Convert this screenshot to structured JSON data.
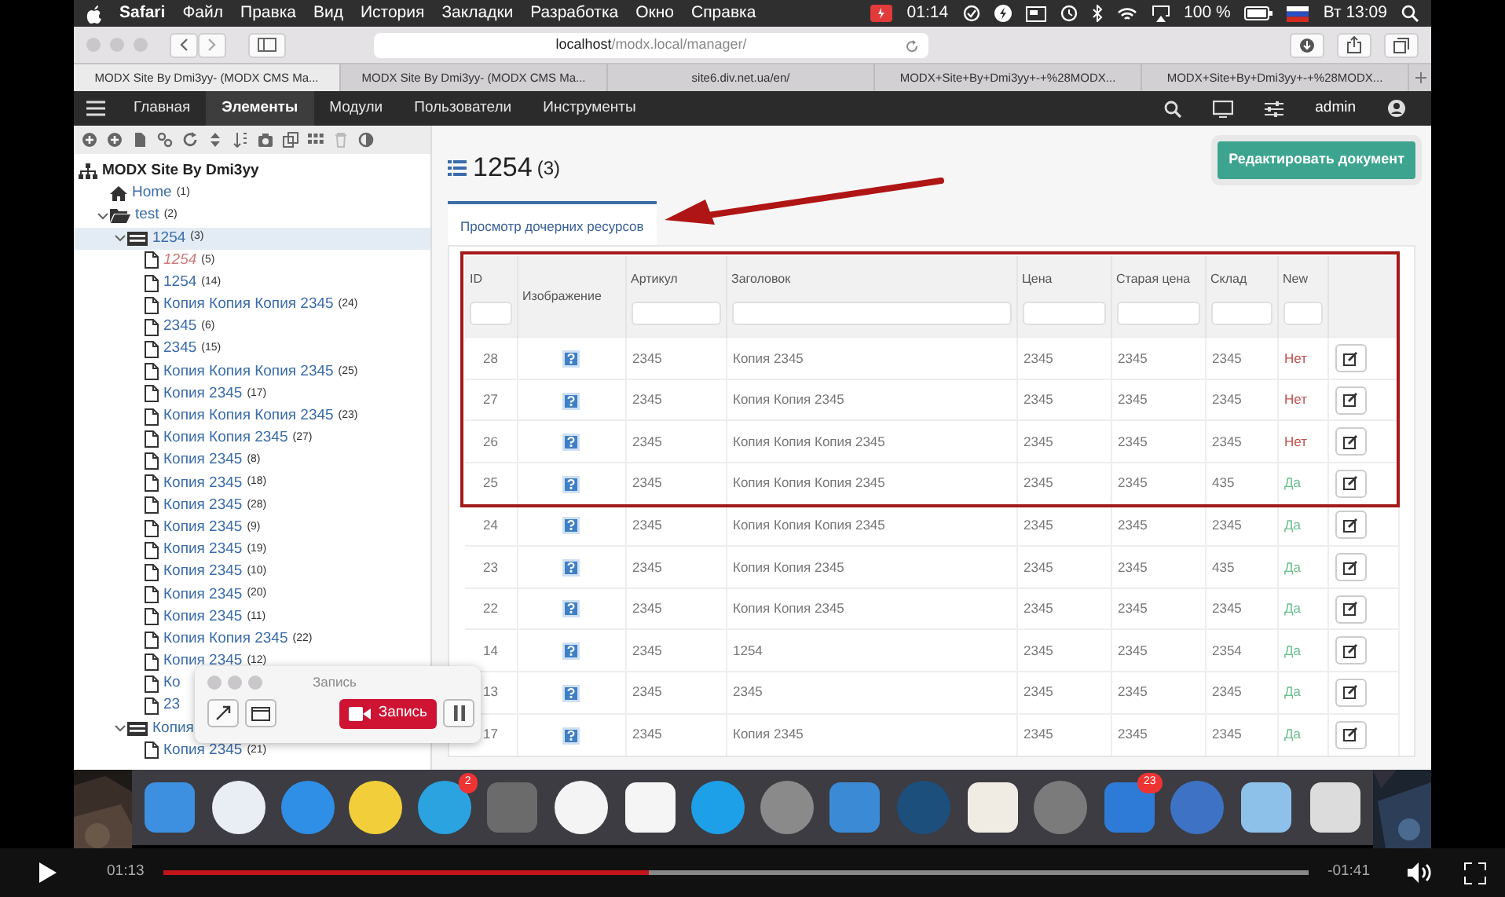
{
  "menubar": {
    "app": "Safari",
    "menus": [
      "Файл",
      "Правка",
      "Вид",
      "История",
      "Закладки",
      "Разработка",
      "Окно",
      "Справка"
    ],
    "recording_time": "01:14",
    "battery": "100 %",
    "clock": "Вт 13:09"
  },
  "safari": {
    "address": "**localhost**/modx.local/manager/",
    "tabs": [
      {
        "title": "MODX Site By Dmi3yy- (MODX CMS Ma...",
        "selected": true
      },
      {
        "title": "MODX Site By Dmi3yy- (MODX CMS Ma...",
        "selected": false
      },
      {
        "title": "site6.div.net.ua/en/",
        "selected": false
      },
      {
        "title": "MODX+Site+By+Dmi3yy+-+%28MODX...",
        "selected": false
      },
      {
        "title": "MODX+Site+By+Dmi3yy+-+%28MODX...",
        "selected": false
      }
    ]
  },
  "nav": {
    "items": [
      {
        "label": "Главная",
        "selected": false
      },
      {
        "label": "Элементы",
        "selected": true
      },
      {
        "label": "Модули",
        "selected": false
      },
      {
        "label": "Пользователи",
        "selected": false
      },
      {
        "label": "Инструменты",
        "selected": false
      }
    ],
    "user": "admin"
  },
  "tree": {
    "root": {
      "kind": "site",
      "label": "MODX Site By Dmi3yy",
      "selected": false,
      "children": [
        {
          "kind": "home",
          "label": "Home",
          "count": "(1)",
          "selected": false,
          "unpublished": false
        },
        {
          "kind": "folder",
          "label": "test",
          "count": "(2)",
          "selected": false,
          "unpublished": false,
          "expanded": true,
          "children": [
            {
              "kind": "container",
              "label": "1254",
              "count": "(3)",
              "selected": true,
              "unpublished": false,
              "expanded": true,
              "children": [
                {
                  "kind": "doc",
                  "label": "1254",
                  "count": "(5)",
                  "selected": false,
                  "unpublished": true
                },
                {
                  "kind": "doc",
                  "label": "1254",
                  "count": "(14)",
                  "selected": false,
                  "unpublished": false
                },
                {
                  "kind": "doc",
                  "label": "Копия Копия Копия 2345",
                  "count": "(24)",
                  "selected": false,
                  "unpublished": false
                },
                {
                  "kind": "doc",
                  "label": "2345",
                  "count": "(6)",
                  "selected": false,
                  "unpublished": false
                },
                {
                  "kind": "doc",
                  "label": "2345",
                  "count": "(15)",
                  "selected": false,
                  "unpublished": false
                },
                {
                  "kind": "doc",
                  "label": "Копия Копия Копия 2345",
                  "count": "(25)",
                  "selected": false,
                  "unpublished": false
                },
                {
                  "kind": "doc",
                  "label": "Копия 2345",
                  "count": "(17)",
                  "selected": false,
                  "unpublished": false
                },
                {
                  "kind": "doc",
                  "label": "Копия Копия Копия 2345",
                  "count": "(23)",
                  "selected": false,
                  "unpublished": false
                },
                {
                  "kind": "doc",
                  "label": "Копия Копия 2345",
                  "count": "(27)",
                  "selected": false,
                  "unpublished": false
                },
                {
                  "kind": "doc",
                  "label": "Копия 2345",
                  "count": "(8)",
                  "selected": false,
                  "unpublished": false
                },
                {
                  "kind": "doc",
                  "label": "Копия 2345",
                  "count": "(18)",
                  "selected": false,
                  "unpublished": false
                },
                {
                  "kind": "doc",
                  "label": "Копия 2345",
                  "count": "(28)",
                  "selected": false,
                  "unpublished": false
                },
                {
                  "kind": "doc",
                  "label": "Копия 2345",
                  "count": "(9)",
                  "selected": false,
                  "unpublished": false
                },
                {
                  "kind": "doc",
                  "label": "Копия 2345",
                  "count": "(19)",
                  "selected": false,
                  "unpublished": false
                },
                {
                  "kind": "doc",
                  "label": "Копия 2345",
                  "count": "(10)",
                  "selected": false,
                  "unpublished": false
                },
                {
                  "kind": "doc",
                  "label": "Копия 2345",
                  "count": "(20)",
                  "selected": false,
                  "unpublished": false
                },
                {
                  "kind": "doc",
                  "label": "Копия 2345",
                  "count": "(11)",
                  "selected": false,
                  "unpublished": false
                },
                {
                  "kind": "doc",
                  "label": "Копия Копия 2345",
                  "count": "(22)",
                  "selected": false,
                  "unpublished": false
                },
                {
                  "kind": "doc",
                  "label": "Копия 2345",
                  "count": "(12)",
                  "selected": false,
                  "unpublished": false
                },
                {
                  "kind": "doc",
                  "label": "Ко",
                  "selected": false,
                  "unpublished": false
                },
                {
                  "kind": "doc",
                  "label": "23",
                  "selected": false,
                  "unpublished": false
                }
              ]
            },
            {
              "kind": "container",
              "label": "Копия",
              "selected": false,
              "unpublished": false,
              "expanded": true,
              "children": [
                {
                  "kind": "doc",
                  "label": "Копия 2345",
                  "count": "(21)",
                  "selected": false,
                  "unpublished": false
                }
              ]
            }
          ]
        }
      ]
    }
  },
  "main": {
    "title": "1254",
    "count": "(3)",
    "edit_button": "Редактировать документ",
    "tabs": [
      {
        "label": "Просмотр дочерних ресурсов",
        "selected": true
      }
    ],
    "table": {
      "columns": [
        {
          "label": "ID",
          "filter": true
        },
        {
          "label": "Изображение",
          "filter": false
        },
        {
          "label": "Артикул",
          "filter": true
        },
        {
          "label": "Заголовок",
          "filter": true
        },
        {
          "label": "Цена",
          "filter": true
        },
        {
          "label": "Старая цена",
          "filter": true
        },
        {
          "label": "Склад",
          "filter": true
        },
        {
          "label": "New",
          "filter": true
        }
      ],
      "rows": [
        {
          "id": "28",
          "sku": "2345",
          "title": "Копия 2345",
          "price": "2345",
          "old_price": "2345",
          "stock": "2345",
          "new": "Нет",
          "is_new": false
        },
        {
          "id": "27",
          "sku": "2345",
          "title": "Копия Копия 2345",
          "price": "2345",
          "old_price": "2345",
          "stock": "2345",
          "new": "Нет",
          "is_new": false
        },
        {
          "id": "26",
          "sku": "2345",
          "title": "Копия Копия Копия 2345",
          "price": "2345",
          "old_price": "2345",
          "stock": "2345",
          "new": "Нет",
          "is_new": false
        },
        {
          "id": "25",
          "sku": "2345",
          "title": "Копия Копия Копия 2345",
          "price": "2345",
          "old_price": "2345",
          "stock": "435",
          "new": "Да",
          "is_new": true
        },
        {
          "id": "24",
          "sku": "2345",
          "title": "Копия Копия Копия 2345",
          "price": "2345",
          "old_price": "2345",
          "stock": "2345",
          "new": "Да",
          "is_new": true
        },
        {
          "id": "23",
          "sku": "2345",
          "title": "Копия Копия 2345",
          "price": "2345",
          "old_price": "2345",
          "stock": "435",
          "new": "Да",
          "is_new": true
        },
        {
          "id": "22",
          "sku": "2345",
          "title": "Копия Копия 2345",
          "price": "2345",
          "old_price": "2345",
          "stock": "2345",
          "new": "Да",
          "is_new": true
        },
        {
          "id": "14",
          "sku": "2345",
          "title": "1254",
          "price": "2345",
          "old_price": "2345",
          "stock": "2354",
          "new": "Да",
          "is_new": true
        },
        {
          "id": "13",
          "sku": "2345",
          "title": "2345",
          "price": "2345",
          "old_price": "2345",
          "stock": "2345",
          "new": "Да",
          "is_new": true
        },
        {
          "id": "17",
          "sku": "2345",
          "title": "Копия 2345",
          "price": "2345",
          "old_price": "2345",
          "stock": "2345",
          "new": "Да",
          "is_new": true
        }
      ]
    }
  },
  "recorder": {
    "title": "Запись",
    "record_button": "Запись"
  },
  "dock": {
    "apps": [
      {
        "kind": "square",
        "color": "#3d8fe0"
      },
      {
        "kind": "circle",
        "color": "#e9eef4"
      },
      {
        "kind": "circle",
        "color": "#2f8ee6"
      },
      {
        "kind": "circle",
        "color": "#f2cf3a"
      },
      {
        "kind": "circle",
        "color": "#2aa3e0",
        "badge": "2"
      },
      {
        "kind": "square",
        "color": "#6b6b6b"
      },
      {
        "kind": "circle",
        "color": "#f4f4f4"
      },
      {
        "kind": "square",
        "color": "#f5f5f5"
      },
      {
        "kind": "circle",
        "color": "#1ea0e8"
      },
      {
        "kind": "circle",
        "color": "#8a8a8a"
      },
      {
        "kind": "square",
        "color": "#3a8ad6"
      },
      {
        "kind": "circle",
        "color": "#1c4f7c"
      },
      {
        "kind": "square",
        "color": "#f0ece4"
      },
      {
        "kind": "circle",
        "color": "#7b7b7b"
      },
      {
        "kind": "square",
        "color": "#2d7bd6",
        "badge": "23"
      },
      {
        "kind": "circle",
        "color": "#3d72c4"
      },
      {
        "kind": "square",
        "color": "#8dc1ea"
      },
      {
        "kind": "square",
        "color": "#dcdcdc"
      }
    ]
  },
  "player": {
    "elapsed": "01:13",
    "remaining": "-01:41",
    "level": 0.424
  }
}
